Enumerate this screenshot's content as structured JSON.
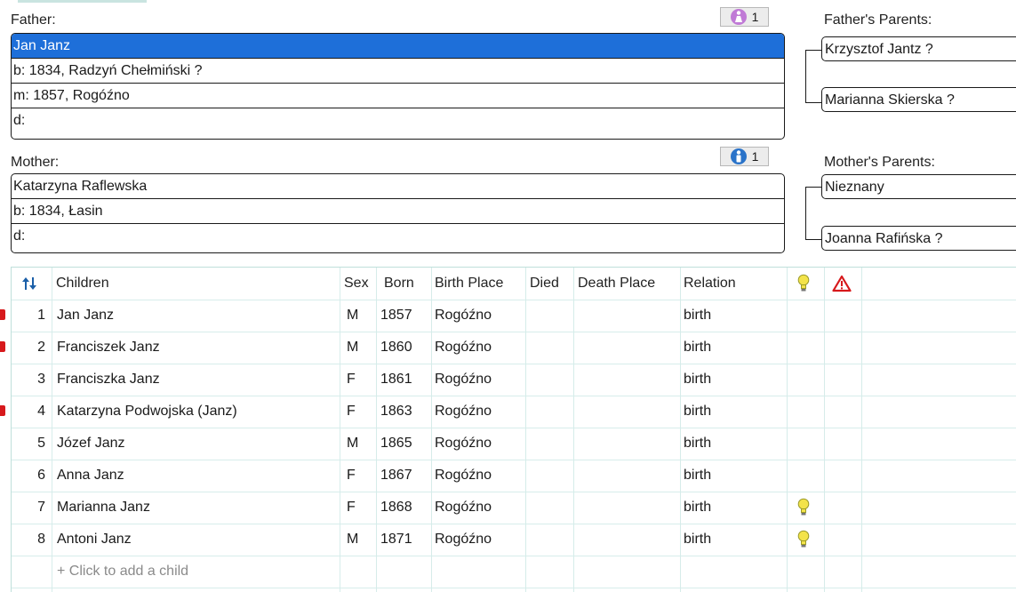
{
  "father": {
    "label": "Father:",
    "name": "Jan Janz",
    "birth": "b: 1834, Radzyń Chełmiński ?",
    "marriage": "m: 1857, Rogóźno",
    "death": "d:",
    "spouse_count": "1",
    "badge_icon": "female-person-icon",
    "badge_color": "#c07ad6"
  },
  "father_parents": {
    "label": "Father's Parents:",
    "father": "Krzysztof Jantz ?",
    "mother": "Marianna Skierska ?"
  },
  "mother": {
    "label": "Mother:",
    "name": "Katarzyna Raflewska",
    "birth": "b: 1834, Łasin",
    "death": "d:",
    "spouse_count": "1",
    "badge_icon": "male-person-icon",
    "badge_color": "#2a73c9"
  },
  "mother_parents": {
    "label": "Mother's Parents:",
    "father": "Nieznany",
    "mother": "Joanna Rafińska ?"
  },
  "children_table": {
    "headers": {
      "sort": "sort-icon",
      "children": "Children",
      "sex": "Sex",
      "born": "Born",
      "birth_place": "Birth Place",
      "died": "Died",
      "death_place": "Death Place",
      "relation": "Relation",
      "hint": "lightbulb-icon",
      "warning": "warning-icon"
    },
    "rows": [
      {
        "num": "1",
        "name": "Jan Janz",
        "sex": "M",
        "born": "1857",
        "birth_place": "Rogóźno",
        "died": "",
        "death_place": "",
        "relation": "birth",
        "marker": true,
        "hint": false
      },
      {
        "num": "2",
        "name": "Franciszek Janz",
        "sex": "M",
        "born": "1860",
        "birth_place": "Rogóźno",
        "died": "",
        "death_place": "",
        "relation": "birth",
        "marker": true,
        "hint": false
      },
      {
        "num": "3",
        "name": "Franciszka Janz",
        "sex": "F",
        "born": "1861",
        "birth_place": "Rogóźno",
        "died": "",
        "death_place": "",
        "relation": "birth",
        "marker": false,
        "hint": false
      },
      {
        "num": "4",
        "name": "Katarzyna Podwojska (Janz)",
        "sex": "F",
        "born": "1863",
        "birth_place": "Rogóźno",
        "died": "",
        "death_place": "",
        "relation": "birth",
        "marker": true,
        "hint": false
      },
      {
        "num": "5",
        "name": "Józef Janz",
        "sex": "M",
        "born": "1865",
        "birth_place": "Rogóźno",
        "died": "",
        "death_place": "",
        "relation": "birth",
        "marker": false,
        "hint": false
      },
      {
        "num": "6",
        "name": "Anna Janz",
        "sex": "F",
        "born": "1867",
        "birth_place": "Rogóźno",
        "died": "",
        "death_place": "",
        "relation": "birth",
        "marker": false,
        "hint": false
      },
      {
        "num": "7",
        "name": "Marianna Janz",
        "sex": "F",
        "born": "1868",
        "birth_place": "Rogóźno",
        "died": "",
        "death_place": "",
        "relation": "birth",
        "marker": false,
        "hint": true
      },
      {
        "num": "8",
        "name": "Antoni Janz",
        "sex": "M",
        "born": "1871",
        "birth_place": "Rogóźno",
        "died": "",
        "death_place": "",
        "relation": "birth",
        "marker": false,
        "hint": true
      }
    ],
    "add_placeholder": "+ Click to add a child"
  },
  "colors": {
    "selection": "#1e6fd9",
    "grid_line": "#d6ecea",
    "marker": "#d7191c",
    "sort_icon": "#1b5fa8",
    "warning_icon": "#d7191c",
    "hint_bulb": "#f3e34a"
  }
}
